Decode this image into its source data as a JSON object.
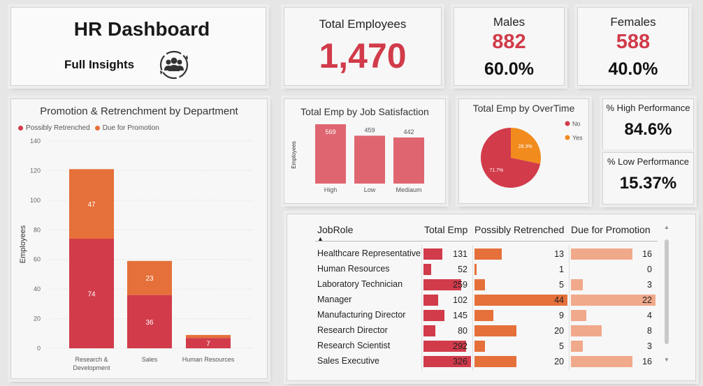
{
  "header": {
    "title": "HR Dashboard",
    "subtitle": "Full Insights",
    "icon": "team-people-icon"
  },
  "kpis": {
    "total": {
      "label": "Total Employees",
      "value": "1,470"
    },
    "males": {
      "label": "Males",
      "value": "882",
      "pct": "60.0%"
    },
    "females": {
      "label": "Females",
      "value": "588",
      "pct": "40.0%"
    },
    "high_perf": {
      "label": "% High Performance",
      "value": "84.6%"
    },
    "low_perf": {
      "label": "% Low Performance",
      "value": "15.37%"
    }
  },
  "colors": {
    "accent": "#d13b4a",
    "orange": "#e5703a",
    "bar_red": "#df6670",
    "light_orange": "#f0a98a",
    "ot_yes": "#f28b1e"
  },
  "chart_data": [
    {
      "type": "bar",
      "stacked": true,
      "title": "Promotion & Retrenchment by Department",
      "ylabel": "Employees",
      "ylim": [
        0,
        140
      ],
      "yticks": [
        0,
        20,
        40,
        60,
        80,
        100,
        120,
        140
      ],
      "categories": [
        "Research & Development",
        "Sales",
        "Human Resources"
      ],
      "series": [
        {
          "name": "Possibly Retrenched",
          "values": [
            74,
            36,
            7
          ],
          "color": "#d13b4a"
        },
        {
          "name": "Due for Promotion",
          "values": [
            47,
            23,
            2
          ],
          "color": "#e5703a"
        }
      ],
      "data_labels": [
        [
          "74",
          "36",
          "7"
        ],
        [
          "47",
          "23",
          ""
        ]
      ],
      "legend": "top-left"
    },
    {
      "type": "bar",
      "title": "Total Emp by Job Satisfaction",
      "ylabel": "Employees",
      "categories": [
        "High",
        "Low",
        "Mediaum"
      ],
      "values": [
        569,
        459,
        442
      ],
      "ylim": [
        0,
        600
      ]
    },
    {
      "type": "pie",
      "title": "Total Emp by OverTime",
      "slices": [
        {
          "name": "No",
          "value": 71.7,
          "label": "71.7%",
          "color": "#d13b4a"
        },
        {
          "name": "Yes",
          "value": 28.3,
          "label": "28.3%",
          "color": "#f28b1e"
        }
      ],
      "legend": "right"
    },
    {
      "type": "table",
      "columns": [
        "JobRole",
        "Total Emp",
        "Possibly Retrenched",
        "Due for Promotion"
      ],
      "sort_indicator": "▲",
      "rows": [
        {
          "role": "Healthcare Representative",
          "total": 131,
          "retrenched": 13,
          "promotion": 16
        },
        {
          "role": "Human Resources",
          "total": 52,
          "retrenched": 1,
          "promotion": 0
        },
        {
          "role": "Laboratory Technician",
          "total": 259,
          "retrenched": 5,
          "promotion": 3
        },
        {
          "role": "Manager",
          "total": 102,
          "retrenched": 44,
          "promotion": 22
        },
        {
          "role": "Manufacturing Director",
          "total": 145,
          "retrenched": 9,
          "promotion": 4
        },
        {
          "role": "Research Director",
          "total": 80,
          "retrenched": 20,
          "promotion": 8
        },
        {
          "role": "Research Scientist",
          "total": 292,
          "retrenched": 5,
          "promotion": 3
        },
        {
          "role": "Sales Executive",
          "total": 326,
          "retrenched": 20,
          "promotion": 16
        }
      ],
      "scale_max": {
        "total": 326,
        "retrenched": 44,
        "promotion": 22
      }
    }
  ]
}
